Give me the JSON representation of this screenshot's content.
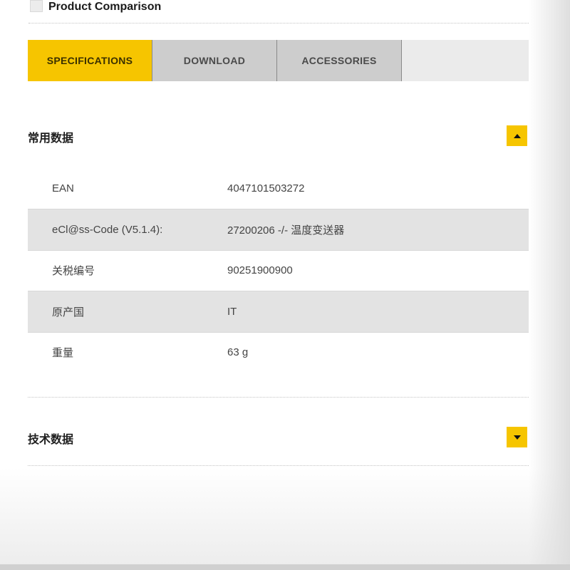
{
  "compare": {
    "label": "Product Comparison"
  },
  "tabs": [
    {
      "label": "SPECIFICATIONS",
      "active": true
    },
    {
      "label": "DOWNLOAD",
      "active": false
    },
    {
      "label": "ACCESSORIES",
      "active": false
    }
  ],
  "sections": {
    "general": {
      "title": "常用数据",
      "expanded": true,
      "rows": [
        {
          "key": "EAN",
          "value": "4047101503272"
        },
        {
          "key": "eCl@ss-Code (V5.1.4):",
          "value": "27200206 -/- 温度变送器"
        },
        {
          "key": "关税编号",
          "value": "90251900900"
        },
        {
          "key": "原产国",
          "value": "IT"
        },
        {
          "key": "重量",
          "value": "63 g"
        }
      ]
    },
    "technical": {
      "title": "技术数据",
      "expanded": false
    }
  },
  "colors": {
    "accent": "#f6c500",
    "tab_inactive": "#cdcdcd",
    "row_alt": "#e3e3e3"
  },
  "icons": {
    "collapse": "triangle-up-icon",
    "expand": "triangle-down-icon"
  }
}
